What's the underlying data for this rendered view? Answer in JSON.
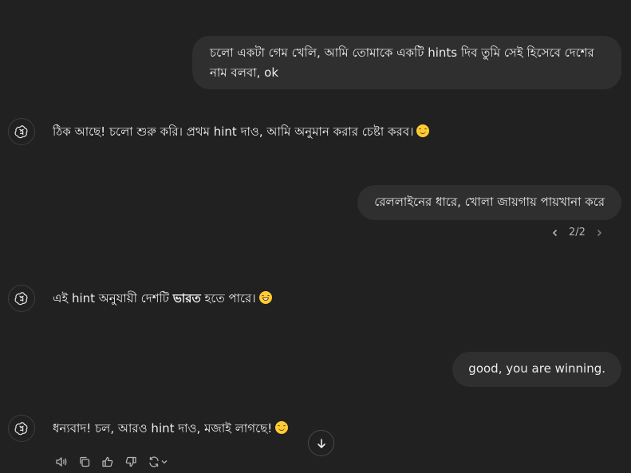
{
  "conversation": {
    "user_1": "চলো একটা গেম খেলি, আমি তোমাকে একটি hints দিব তুমি সেই হিসেবে দেশের নাম বলবা, ok",
    "assistant_1": "ঠিক আছে! চলো শুরু করি। প্রথম hint দাও, আমি অনুমান করার চেষ্টা করব।",
    "user_2": "রেললাইনের ধারে, খোলা জায়গায় পায়খানা করে",
    "pager": "2/2",
    "assistant_2_before": "এই hint অনুযায়ী দেশটি ",
    "assistant_2_bold": "ভারত",
    "assistant_2_after": " হতে পারে।",
    "user_3": "good, you are winning.",
    "assistant_3": "ধন্যবাদ! চল, আরও hint দাও, মজাই লাগছে!"
  },
  "icons": {
    "avatar": "openai-logo-icon",
    "prev": "chevron-left-icon",
    "next": "chevron-right-icon",
    "scroll": "arrow-down-icon",
    "actions": [
      "speaker-icon",
      "copy-icon",
      "thumbs-up-icon",
      "thumbs-down-icon",
      "regenerate-icon"
    ]
  },
  "colors": {
    "background": "#212121",
    "bubble": "#2f2f2f",
    "text": "#ececec",
    "muted": "#b4b4b4"
  }
}
